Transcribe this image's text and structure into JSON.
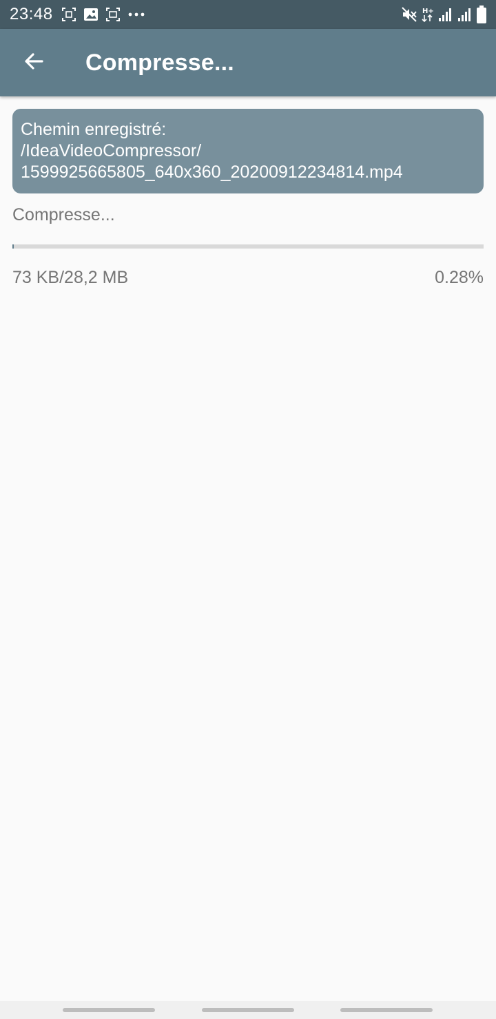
{
  "status_bar": {
    "time": "23:48",
    "left_icons": [
      "screenshot-icon",
      "image-icon",
      "screen-record-icon",
      "more-dots-icon"
    ],
    "right_icons": [
      "mute-icon",
      "hplus-data-icon",
      "signal-icon",
      "signal-icon-2",
      "battery-icon"
    ]
  },
  "app_bar": {
    "title": "Compresse...",
    "back_icon": "arrow-back-icon"
  },
  "path_box": {
    "line1": "Chemin enregistré:",
    "line2": "/IdeaVideoCompressor/",
    "line3": "1599925665805_640x360_20200912234814.mp4"
  },
  "progress": {
    "status": "Compresse...",
    "size_text": "73 KB/28,2 MB",
    "percent_text": "0.28%",
    "fraction": 0.0028
  },
  "colors": {
    "status_bar": "#455a64",
    "app_bar": "#607d8b",
    "path_box": "#78909c",
    "background": "#fafafa"
  }
}
